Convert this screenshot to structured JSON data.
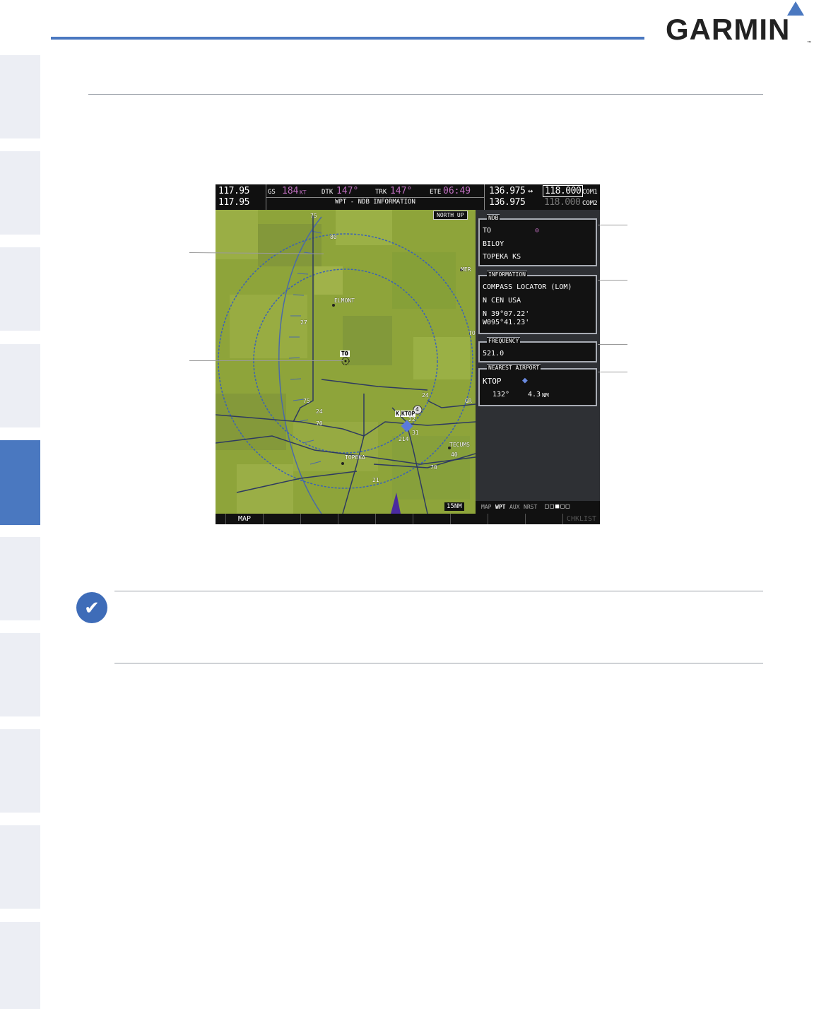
{
  "brand": {
    "name": "GARMIN",
    "trademark": "™"
  },
  "screen": {
    "nav1_active": "117.95",
    "nav1_standby": "117.95",
    "gs_label": "GS",
    "gs_value": "184",
    "gs_unit": "KT",
    "dtk_label": "DTK",
    "dtk_value": "147°",
    "trk_label": "TRK",
    "trk_value": "147°",
    "ete_label": "ETE",
    "ete_value": "06:49",
    "page_title": "WPT - NDB INFORMATION",
    "com1_active": "136.975",
    "com_swap": "↔",
    "com1_standby": "118.000",
    "com1_label": "COM1",
    "com2_active": "136.975",
    "com2_standby": "118.000",
    "com2_label": "COM2",
    "map": {
      "orientation": "NORTH UP",
      "range": "15NM",
      "labels": {
        "elmont": "ELMONT",
        "topeka": "TOPEKA",
        "tecums": "TECUMS",
        "mer": "MER",
        "gr": "GR",
        "to_cut": "TO",
        "ktop": "KTOP",
        "kfoe_part": "K",
        "ndb_id": "TO",
        "hwy75_top": "75",
        "hwy75": "75",
        "hwy70": "70",
        "hwy70b": "70",
        "r80": "80",
        "r27": "27",
        "r4": "4",
        "r24": "24",
        "r22": "22",
        "r31": "31",
        "r214": "214",
        "r21": "21",
        "r40": "40",
        "r24b": "24"
      }
    },
    "ndb_box": {
      "title": "NDB",
      "identifier": "TO",
      "name": "BILOY",
      "city": "TOPEKA KS"
    },
    "info_box": {
      "title": "INFORMATION",
      "type": "COMPASS LOCATOR (LOM)",
      "region": "N CEN USA",
      "lat": "N 39°07.22'",
      "lon": "W095°41.23'"
    },
    "freq_box": {
      "title": "FREQUENCY",
      "value": "521.0"
    },
    "nearest_box": {
      "title": "NEAREST AIRPORT",
      "ident": "KTOP",
      "bearing": "132°",
      "distance": "4.3",
      "distance_unit": "NM"
    },
    "page_group": {
      "labels": [
        "MAP",
        "WPT",
        "AUX",
        "NRST"
      ]
    },
    "softkeys": [
      "",
      "MAP",
      "",
      "",
      "",
      "",
      "",
      "",
      "",
      "",
      "CHKLIST"
    ]
  },
  "colors": {
    "accent": "#4a78c0",
    "magenta": "#c070c0",
    "map_green": "#8ea43a"
  }
}
